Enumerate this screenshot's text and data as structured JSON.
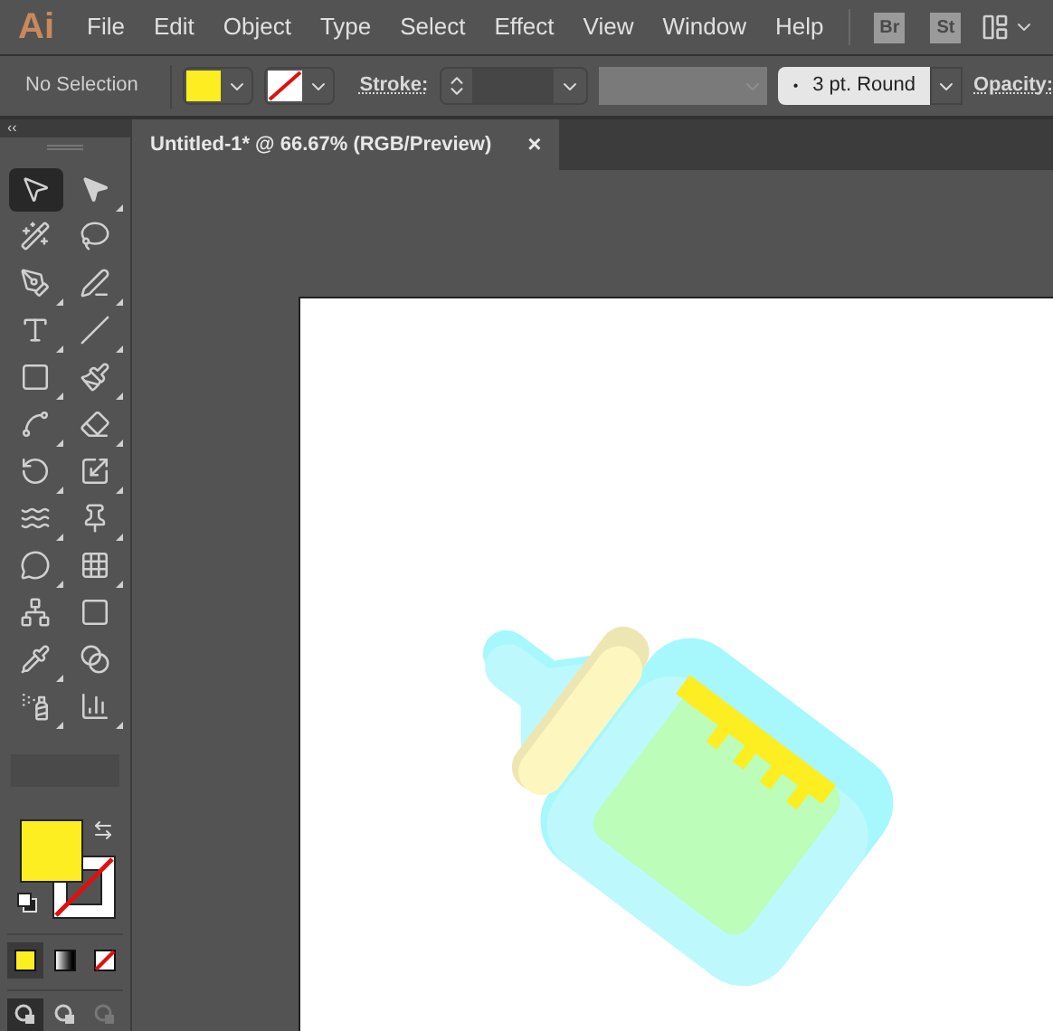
{
  "app": {
    "logo": "Ai"
  },
  "menu": [
    "File",
    "Edit",
    "Object",
    "Type",
    "Select",
    "Effect",
    "View",
    "Window",
    "Help"
  ],
  "app_buttons": [
    "Br",
    "St"
  ],
  "control_bar": {
    "selection": "No Selection",
    "fill": {
      "color": "#fdee21"
    },
    "stroke_none": true,
    "stroke_label": "Stroke:",
    "brush_dot": "•",
    "brush": "3 pt. Round",
    "opacity_label": "Opacity:"
  },
  "panel_collapse": "‹‹",
  "tools": [
    {
      "kind": "selection",
      "selected": true,
      "flyout": false
    },
    {
      "kind": "direct-selection",
      "selected": false,
      "flyout": true
    },
    {
      "kind": "magic-wand",
      "selected": false,
      "flyout": false
    },
    {
      "kind": "lasso",
      "selected": false,
      "flyout": false
    },
    {
      "kind": "pen",
      "selected": false,
      "flyout": true
    },
    {
      "kind": "curvature",
      "selected": false,
      "flyout": true
    },
    {
      "kind": "type",
      "selected": false,
      "flyout": true
    },
    {
      "kind": "line",
      "selected": false,
      "flyout": true
    },
    {
      "kind": "rectangle",
      "selected": false,
      "flyout": true
    },
    {
      "kind": "paintbrush",
      "selected": false,
      "flyout": true
    },
    {
      "kind": "shaper",
      "selected": false,
      "flyout": true
    },
    {
      "kind": "eraser",
      "selected": false,
      "flyout": true
    },
    {
      "kind": "rotate",
      "selected": false,
      "flyout": true
    },
    {
      "kind": "scale",
      "selected": false,
      "flyout": true
    },
    {
      "kind": "warp",
      "selected": false,
      "flyout": true
    },
    {
      "kind": "puppet",
      "selected": false,
      "flyout": true
    },
    {
      "kind": "shape-builder",
      "selected": false,
      "flyout": true
    },
    {
      "kind": "perspective",
      "selected": false,
      "flyout": true
    },
    {
      "kind": "mesh",
      "selected": false,
      "flyout": false
    },
    {
      "kind": "gradient",
      "selected": false,
      "flyout": false
    },
    {
      "kind": "eyedropper",
      "selected": false,
      "flyout": true
    },
    {
      "kind": "blend",
      "selected": false,
      "flyout": false
    },
    {
      "kind": "symbol-sprayer",
      "selected": false,
      "flyout": true
    },
    {
      "kind": "graph",
      "selected": false,
      "flyout": true
    }
  ],
  "color_modes": [
    {
      "kind": "color",
      "selected": true
    },
    {
      "kind": "gradient",
      "selected": false
    },
    {
      "kind": "none",
      "selected": false
    }
  ],
  "draw_modes": [
    {
      "kind": "normal",
      "selected": true
    },
    {
      "kind": "behind",
      "selected": false
    },
    {
      "kind": "inside",
      "selected": false
    }
  ],
  "document_tab": {
    "title": "Untitled-1* @ 66.67% (RGB/Preview)",
    "close": "×"
  }
}
